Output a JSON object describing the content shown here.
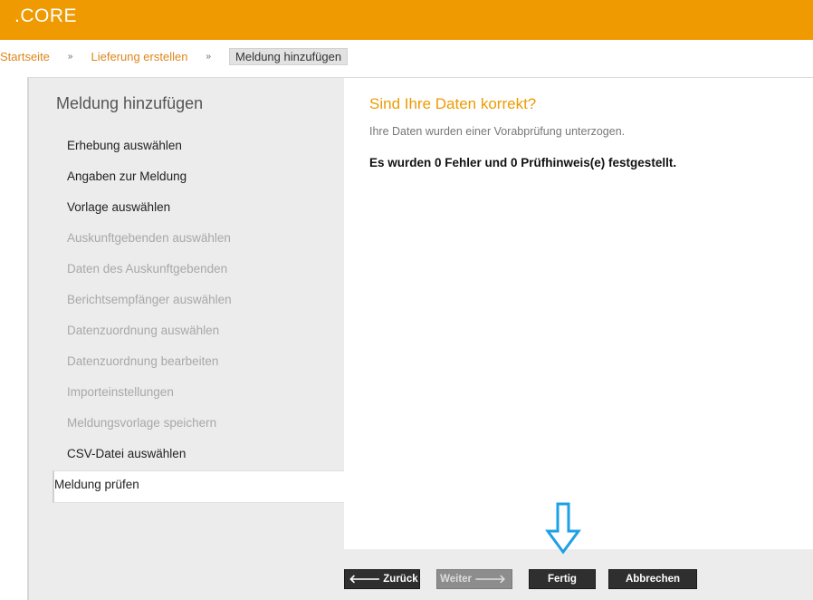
{
  "app": {
    "brand": ".CORE"
  },
  "breadcrumb": {
    "items": [
      "Startseite",
      "Lieferung erstellen"
    ],
    "current": "Meldung hinzufügen",
    "separator": "»"
  },
  "sidebar": {
    "title": "Meldung hinzufügen",
    "steps": [
      {
        "label": "Erhebung auswählen",
        "state": "enabled"
      },
      {
        "label": "Angaben zur Meldung",
        "state": "enabled"
      },
      {
        "label": "Vorlage auswählen",
        "state": "enabled"
      },
      {
        "label": "Auskunftgebenden auswählen",
        "state": "disabled"
      },
      {
        "label": "Daten des Auskunftgebenden",
        "state": "disabled"
      },
      {
        "label": "Berichtsempfänger auswählen",
        "state": "disabled"
      },
      {
        "label": "Datenzuordnung auswählen",
        "state": "disabled"
      },
      {
        "label": "Datenzuordnung bearbeiten",
        "state": "disabled"
      },
      {
        "label": "Importeinstellungen",
        "state": "disabled"
      },
      {
        "label": "Meldungsvorlage speichern",
        "state": "disabled"
      },
      {
        "label": "CSV-Datei auswählen",
        "state": "enabled"
      },
      {
        "label": "Meldung prüfen",
        "state": "active"
      }
    ]
  },
  "content": {
    "title": "Sind Ihre Daten korrekt?",
    "subtitle": "Ihre Daten wurden einer Vorabprüfung unterzogen.",
    "result": "Es wurden 0 Fehler und 0 Prüfhinweis(e) festgestellt."
  },
  "buttons": {
    "back": "Zurück",
    "next": "Weiter",
    "finish": "Fertig",
    "cancel": "Abbrechen"
  },
  "colors": {
    "accent": "#ee9a00",
    "arrow": "#1ea0e6",
    "button": "#2f2f2f"
  },
  "icons": {
    "back": "arrow-left-icon",
    "next": "arrow-right-icon",
    "pointer": "arrow-down-icon"
  }
}
